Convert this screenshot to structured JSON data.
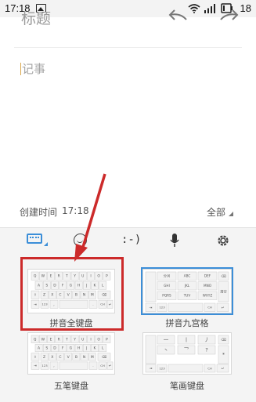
{
  "status_bar": {
    "time": "17:18",
    "battery_level": "18"
  },
  "editor": {
    "title_placeholder": "标题",
    "body_placeholder": "记事",
    "created_label": "创建时间",
    "created_time": "17:18",
    "filter_label": "全部"
  },
  "keyboard_toolbar": {
    "emoticon_text": ":-)",
    "icons": [
      "keyboard-icon",
      "smiley-icon",
      "emoticon-text",
      "microphone-icon",
      "gear-icon"
    ]
  },
  "keyboards": [
    {
      "label": "拼音全键盘",
      "highlighted": true
    },
    {
      "label": "拼音九宫格",
      "selected": true
    },
    {
      "label": "五笔键盘"
    },
    {
      "label": "笔画键盘"
    }
  ],
  "thumbs": {
    "qwerty_row1": [
      "Q",
      "W",
      "E",
      "R",
      "T",
      "Y",
      "U",
      "I",
      "O",
      "P"
    ],
    "qwerty_row2": [
      "A",
      "S",
      "D",
      "F",
      "G",
      "H",
      "J",
      "K",
      "L"
    ],
    "qwerty_row3": [
      "Z",
      "X",
      "C",
      "V",
      "B",
      "N",
      "M"
    ],
    "nine_grid": [
      "分词",
      "ABC",
      "DEF",
      "GHI",
      "JKL",
      "MNO",
      "PQRS",
      "TUV",
      "WXYZ"
    ],
    "nine_side_right": "清空",
    "nine_bottom_left": "123",
    "nine_bottom_right": "CH",
    "stroke_keys": [
      "一",
      "丨",
      "丿",
      "丶",
      "乛",
      "?"
    ]
  },
  "colors": {
    "accent": "#3b8ed8",
    "annotation_red": "#cc2a2a"
  }
}
